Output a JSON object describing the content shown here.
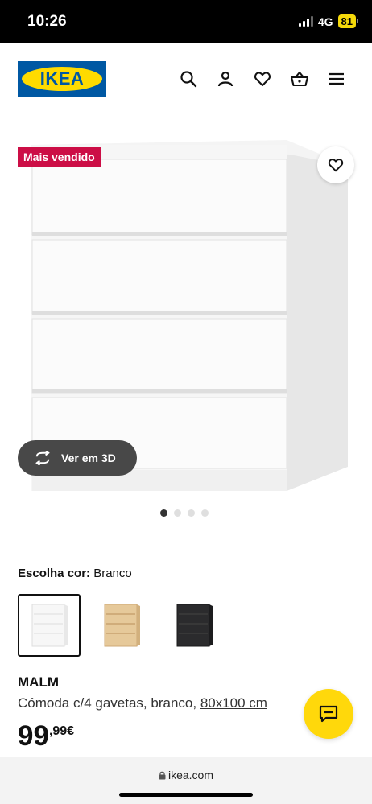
{
  "status": {
    "time": "10:26",
    "network": "4G",
    "battery": "81"
  },
  "header": {
    "logo_text": "IKEA",
    "icons": [
      "search-icon",
      "account-icon",
      "heart-icon",
      "cart-icon",
      "menu-icon"
    ]
  },
  "product_image": {
    "badge": "Mais vendido",
    "view_3d_label": "Ver em 3D",
    "carousel_total": 4,
    "carousel_active": 1
  },
  "color": {
    "label": "Escolha cor:",
    "value": "Branco",
    "swatches": [
      "white",
      "white-stained-oak",
      "black-brown"
    ],
    "selected_index": 0
  },
  "product": {
    "name": "MALM",
    "description": "Cómoda c/4 gavetas, branco,",
    "size": "80x100 cm",
    "price_int": "99",
    "price_dec": ",99€"
  },
  "browser": {
    "url": "ikea.com"
  },
  "colors": {
    "ikea_blue": "#0058a3",
    "ikea_yellow": "#ffdb00",
    "badge_red": "#cc0e46",
    "chat_yellow": "#ffd80b"
  }
}
